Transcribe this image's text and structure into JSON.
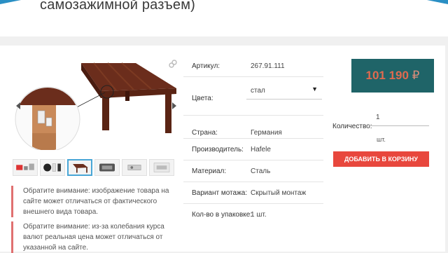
{
  "page": {
    "title_fragment": "самозажимной разъем)"
  },
  "product": {
    "gallery": {
      "main_image": "table-with-connector-closeup",
      "thumbnails": [
        "parts-set",
        "black-white-parts",
        "table",
        "clip-tool",
        "connector-metal",
        "packaging"
      ],
      "active_thumbnail_index": 3
    },
    "notices": [
      "Обратите внимание: изображение товара на сайте может отличаться от фактического внешнего вида товара.",
      "Обратите внимание: из-за колебания курса валют реальная цена может отличаться от указанной на сайте."
    ],
    "specs": {
      "article": {
        "label": "Артикул:",
        "value": "267.91.111"
      },
      "colors": {
        "label": "Цвета:",
        "value": "стал",
        "caret": "▼"
      },
      "country": {
        "label": "Страна:",
        "value": "Германия"
      },
      "manufacturer": {
        "label": "Производитель:",
        "value": "Hafele"
      },
      "material": {
        "label": "Материал:",
        "value": "Сталь"
      },
      "mount": {
        "label": "Вариант мотажа:",
        "value": "Скрытый монтаж"
      },
      "package": {
        "label": "Кол-во в упаковке:",
        "value": "1 шт."
      }
    },
    "buy": {
      "price": "101 190",
      "currency": "₽",
      "qty_label": "Количество:",
      "qty_value": "1",
      "qty_unit": "шт.",
      "add_to_cart": "ДОБАВИТЬ В КОРЗИНУ"
    }
  },
  "colors": {
    "accent_blue": "#2a8fc4",
    "price_bg": "#1f6468",
    "price_text": "#e06a4f",
    "cart_button": "#e8473d",
    "notice_border": "#e07070"
  }
}
